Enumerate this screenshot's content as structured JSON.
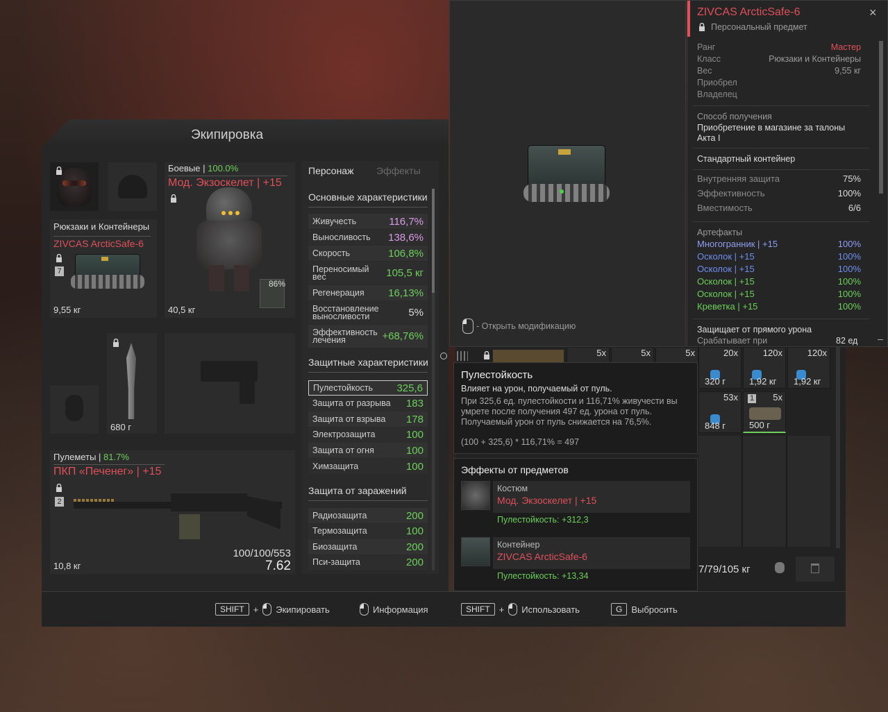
{
  "equipment": {
    "title": "Экипировка",
    "container": {
      "category": "Рюкзаки и Контейнеры",
      "name": "ZIVCAS ArcticSafe-6",
      "slots_badge": "7",
      "weight": "9,55 кг"
    },
    "armor": {
      "category": "Боевые",
      "condition": "100.0%",
      "name": "Мод. Экзоскелет | +15",
      "weight": "40,5 кг",
      "mod_percent": "86%"
    },
    "knife": {
      "weight": "680 г"
    },
    "gun": {
      "category": "Пулеметы",
      "condition": "81.7%",
      "name": "ПКП «Печенег» | +15",
      "badge": "2",
      "ammo": "100/100/553",
      "caliber": "7.62",
      "weight": "10,8 кг"
    }
  },
  "stats": {
    "tabs": [
      "Персонаж",
      "Эффекты"
    ],
    "main_title": "Основные характеристики",
    "main": [
      {
        "name": "Живучесть",
        "value": "116,7%",
        "color": "#d79be6"
      },
      {
        "name": "Выносливость",
        "value": "138,6%",
        "color": "#d79be6"
      },
      {
        "name": "Скорость",
        "value": "106,8%",
        "color": "#6cd05a"
      },
      {
        "name": "Переносимый вес",
        "value": "105,5 кг",
        "color": "#6cd05a"
      },
      {
        "name": "Регенерация",
        "value": "16,13%",
        "color": "#6cd05a"
      },
      {
        "name": "Восстановление выносливости",
        "value": "5%",
        "color": "#dddddd"
      },
      {
        "name": "Эффективность лечения",
        "value": "+68,76%",
        "color": "#6cd05a"
      }
    ],
    "prot_title": "Защитные характеристики",
    "prot": [
      {
        "name": "Пулестойкость",
        "value": "325,6"
      },
      {
        "name": "Защита от разрыва",
        "value": "183"
      },
      {
        "name": "Защита от взрыва",
        "value": "178"
      },
      {
        "name": "Электрозащита",
        "value": "100"
      },
      {
        "name": "Защита от огня",
        "value": "100"
      },
      {
        "name": "Химзащита",
        "value": "100"
      }
    ],
    "cont_title": "Защита от заражений",
    "cont": [
      {
        "name": "Радиозащита",
        "value": "200"
      },
      {
        "name": "Термозащита",
        "value": "100"
      },
      {
        "name": "Биозащита",
        "value": "200"
      },
      {
        "name": "Пси-защита",
        "value": "200"
      }
    ]
  },
  "footer": {
    "shift": "SHIFT",
    "plus": "+",
    "equip": "Экипировать",
    "info": "Информация",
    "use": "Использовать",
    "g": "G",
    "drop": "Выбросить"
  },
  "preview": {
    "open_mod": "- Открыть модификацию"
  },
  "item_info": {
    "name": "ZIVCAS ArcticSafe-6",
    "personal": "Персональный предмет",
    "props": [
      {
        "k": "Ранг",
        "v": "Мастер",
        "color": "#e0505a"
      },
      {
        "k": "Класс",
        "v": "Рюкзаки и Контейнеры",
        "color": "#9a9a9a"
      },
      {
        "k": "Вес",
        "v": "9,55 кг",
        "color": "#9a9a9a"
      },
      {
        "k": "Приобрел",
        "v": ""
      },
      {
        "k": "Владелец",
        "v": ""
      }
    ],
    "obtain_label": "Способ получения",
    "obtain_text": "Приобретение в магазине за талоны Акта I",
    "standard": "Стандартный контейнер",
    "cstats": [
      {
        "k": "Внутренняя защита",
        "v": "75%"
      },
      {
        "k": "Эффективность",
        "v": "100%"
      },
      {
        "k": "Вместимость",
        "v": "6/6"
      }
    ],
    "art_label": "Артефакты",
    "artifacts": [
      {
        "name": "Многогранник | +15",
        "value": "100%",
        "color": "#8f9ef0"
      },
      {
        "name": "Осколок | +15",
        "value": "100%",
        "color": "#6f8ff0"
      },
      {
        "name": "Осколок | +15",
        "value": "100%",
        "color": "#6f8ff0"
      },
      {
        "name": "Осколок | +15",
        "value": "100%",
        "color": "#6cd05a"
      },
      {
        "name": "Осколок | +15",
        "value": "100%",
        "color": "#6cd05a"
      },
      {
        "name": "Креветка | +15",
        "value": "100%",
        "color": "#6cd05a"
      }
    ],
    "protects": "Защищает от прямого урона",
    "triggers": "Срабатывает при",
    "triggers_value": "82 ед"
  },
  "tooltip": {
    "title": "Пулестойкость",
    "desc": "Влияет на урон, получаемый от пуль.",
    "text": "При 325,6 ед. пулестойкости и 116,71% живучести вы умрете после получения 497 ед. урона от пуль. Получаемый урон от пуль снижается на 76,5%.",
    "formula": "(100 + 325,6) * 116,71% = 497"
  },
  "effects": {
    "title": "Эффекты от предметов",
    "items": [
      {
        "type": "Костюм",
        "name": "Мод. Экзоскелет | +15",
        "effect": "Пулестойкость: +312,3"
      },
      {
        "type": "Контейнер",
        "name": "ZIVCAS ArcticSafe-6",
        "effect": "Пулестойкость: +13,34"
      }
    ]
  },
  "inventory": {
    "top_counts": [
      "5x",
      "5x",
      "5x"
    ],
    "cells": [
      {
        "q": "20x",
        "w": "320 г"
      },
      {
        "q": "120x",
        "w": "1,92 кг"
      },
      {
        "q": "120x",
        "w": "1,92 кг"
      },
      {
        "q": "53x",
        "w": "848 г"
      },
      {
        "q": "5x",
        "w": "500 г",
        "badge": "1"
      }
    ],
    "weight": "7/79/105 кг"
  }
}
